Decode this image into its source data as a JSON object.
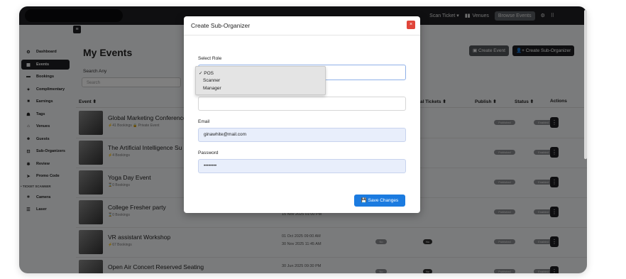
{
  "topbar": {
    "browse_label": "Browse Events",
    "venues_label": "Venues",
    "scan_label": "Scan Ticket ▾"
  },
  "sidebar": {
    "items": [
      {
        "label": "Dashboard",
        "icon": "⚙"
      },
      {
        "label": "Events",
        "icon": "▦"
      },
      {
        "label": "Bookings",
        "icon": "▬"
      },
      {
        "label": "Complimentary",
        "icon": "✦"
      },
      {
        "label": "Earnings",
        "icon": "■"
      },
      {
        "label": "Tags",
        "icon": "☗"
      },
      {
        "label": "Venues",
        "icon": "⌂"
      },
      {
        "label": "Guests",
        "icon": "☻"
      },
      {
        "label": "Sub-Organizers",
        "icon": "⊡"
      },
      {
        "label": "Review",
        "icon": "✱"
      },
      {
        "label": "Promo Code",
        "icon": "➤"
      }
    ],
    "section_label": "• TICKET SCANNER",
    "scanner_items": [
      {
        "label": "Camera",
        "icon": "⌗"
      },
      {
        "label": "Laser",
        "icon": "☰"
      }
    ]
  },
  "main": {
    "title": "My Events",
    "search_label": "Search Any",
    "search_placeholder": "Search",
    "create_event_label": "▣ Create Event",
    "create_sub_label": "👤+ Create Sub-Organizer",
    "columns": {
      "event": "Event ⬍",
      "tickets": "al Tickets ⬍",
      "publish": "Publish ⬍",
      "status": "Status ⬍",
      "actions": "Actions"
    },
    "rows": [
      {
        "name": "Global Marketing Conference",
        "meta": "⚡41 Bookings  🔒 Private Event",
        "date1": "",
        "date2": ""
      },
      {
        "name": "The Artificial Intelligence Su",
        "meta": "⚡4 Bookings",
        "date1": "",
        "date2": ""
      },
      {
        "name": "Yoga Day Event",
        "meta": "⌛0 Bookings",
        "date1": "",
        "date2": ""
      },
      {
        "name": "College Fresher party",
        "meta": "⌛0 Bookings",
        "date1": "",
        "date2": "15 Nov 2025 01:00 PM"
      },
      {
        "name": "VR assistant Workshop",
        "meta": "⚡67 Bookings",
        "date1": "01 Oct 2025 09:00 AM",
        "date2": "30 Nov 2025 11:45 AM"
      },
      {
        "name": "Open Air Concert Reserved Seating",
        "meta": "",
        "date1": "30 Jun 2025 09:30 PM",
        "date2": ""
      }
    ],
    "publish_badge": "Published",
    "status_badge": "Enabled",
    "no_badge": "No",
    "actions_glyph": "⋮"
  },
  "modal": {
    "title": "Create Sub-Organizer",
    "close_glyph": "×",
    "role_label": "Select Role",
    "role_options": [
      "✓ POS",
      "Scanner",
      "Manager"
    ],
    "email_label": "Email",
    "email_value": "ginawhite@mail.com",
    "password_label": "Password",
    "password_value": "••••••••",
    "save_label": "💾 Save Changes"
  }
}
